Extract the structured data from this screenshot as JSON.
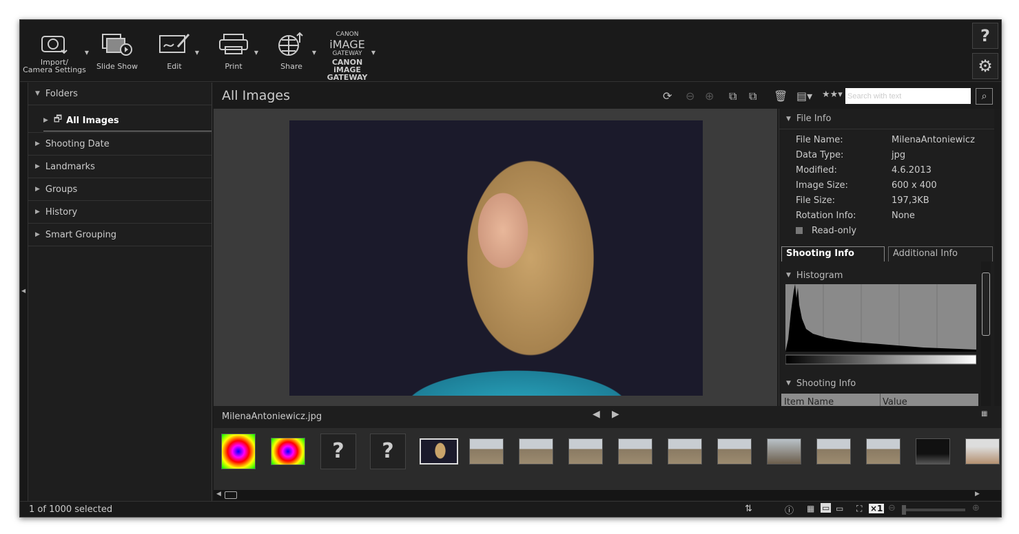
{
  "toolbar": {
    "items": [
      {
        "label": "Import/\nCamera Settings",
        "icon": "camera-import-icon",
        "dropdown": true
      },
      {
        "label": "Slide Show",
        "icon": "slideshow-icon",
        "dropdown": false
      },
      {
        "label": "Edit",
        "icon": "edit-icon",
        "dropdown": true
      },
      {
        "label": "Print",
        "icon": "printer-icon",
        "dropdown": true
      },
      {
        "label": "Share",
        "icon": "globe-share-icon",
        "dropdown": true
      },
      {
        "label": "CANON iMAGE\nGATEWAY",
        "icon": "canon-image-gateway-logo",
        "dropdown": true
      }
    ],
    "logo_text": "CANON iMAGE GATEWAY",
    "help": "?",
    "settings": "gear-icon"
  },
  "sidebar": {
    "header": "Folders",
    "selected": "All Images",
    "items": [
      "Shooting Date",
      "Landmarks",
      "Groups",
      "History",
      "Smart Grouping"
    ]
  },
  "main": {
    "title": "All Images",
    "search_placeholder": "Search with text",
    "filename": "MilenaAntoniewicz.jpg"
  },
  "file_info": {
    "header": "File Info",
    "rows": [
      {
        "label": "File Name:",
        "value": "MilenaAntoniewicz"
      },
      {
        "label": "Data Type:",
        "value": "jpg"
      },
      {
        "label": "Modified:",
        "value": "4.6.2013"
      },
      {
        "label": "Image Size:",
        "value": "600 x 400"
      },
      {
        "label": "File Size:",
        "value": "197,3KB"
      },
      {
        "label": "Rotation Info:",
        "value": "None"
      }
    ],
    "readonly": "Read-only"
  },
  "tabs": [
    "Shooting Info",
    "Additional Info"
  ],
  "histogram": {
    "header": "Histogram"
  },
  "shooting_info": {
    "header": "Shooting Info",
    "columns": [
      "Item Name",
      "Value"
    ]
  },
  "thumbnails": [
    "rainbow",
    "rainbow",
    "unknown",
    "unknown",
    "portrait",
    "house",
    "house",
    "house",
    "house",
    "house",
    "house",
    "tree",
    "house",
    "house",
    "dark",
    "window"
  ],
  "unknown_glyph": "?",
  "status": {
    "selected": "1 of 1000 selected",
    "zoom": "×1"
  }
}
